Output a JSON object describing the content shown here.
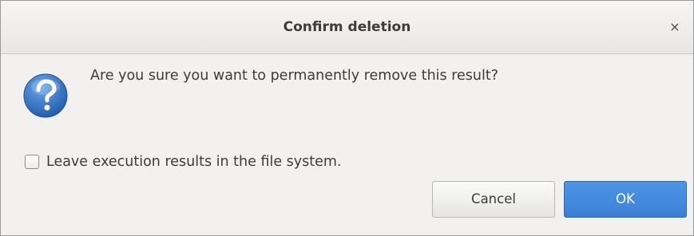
{
  "dialog": {
    "title": "Confirm deletion",
    "close_glyph": "×",
    "icon": "question-icon",
    "message": "Are you sure you want to permanently remove this result?",
    "checkbox": {
      "label": "Leave execution results in the file system.",
      "checked": false
    },
    "buttons": {
      "cancel_label": "Cancel",
      "ok_label": "OK"
    }
  },
  "colors": {
    "accent": "#3b80d6",
    "icon_blue": "#2f6fbd",
    "text": "#3c3c3c",
    "background": "#f2f1f0"
  }
}
